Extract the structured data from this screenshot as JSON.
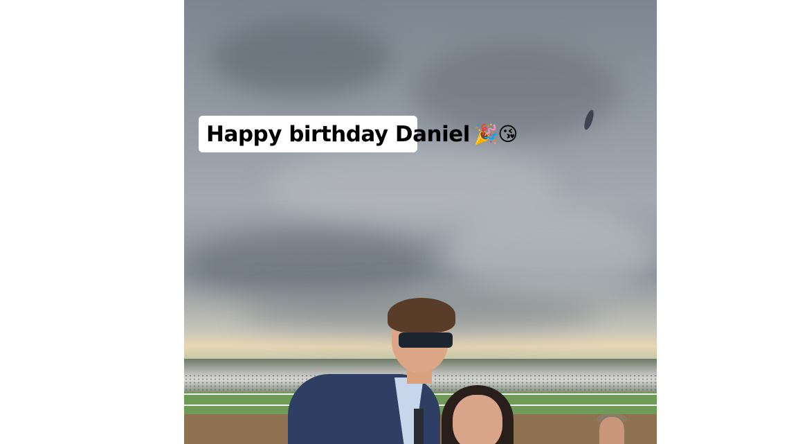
{
  "story": {
    "caption_text": "Happy birthday Daniel",
    "caption_emoji": "🎉😘"
  },
  "colors": {
    "sky": "#8d959e",
    "grass": "#6f9a58",
    "dirt": "#8e7252",
    "suit": "#2e3f63"
  }
}
